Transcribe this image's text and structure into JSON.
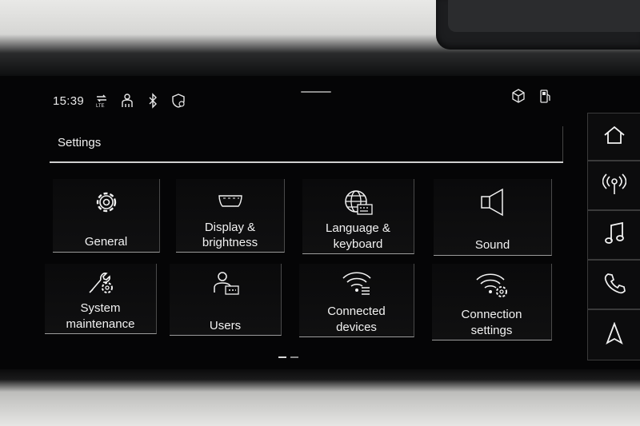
{
  "status_bar": {
    "time": "15:39",
    "icons": [
      "lte-data-icon",
      "person-icon",
      "bluetooth-icon",
      "location-shield-icon"
    ],
    "right_icons": [
      "package-icon",
      "fuel-icon"
    ]
  },
  "header": {
    "title": "Settings"
  },
  "tiles": [
    {
      "label": "General",
      "icon": "gear-icon"
    },
    {
      "label": "Display & brightness",
      "line1": "Display &",
      "line2": "brightness",
      "icon": "display-icon"
    },
    {
      "label": "Language & keyboard",
      "line1": "Language &",
      "line2": "keyboard",
      "icon": "globe-keyboard-icon"
    },
    {
      "label": "Sound",
      "icon": "speaker-icon"
    },
    {
      "label": "System maintenance",
      "line1": "System",
      "line2": "maintenance",
      "icon": "wrench-gear-icon"
    },
    {
      "label": "Users",
      "icon": "user-icon"
    },
    {
      "label": "Connected devices",
      "line1": "Connected",
      "line2": "devices",
      "icon": "wifi-devices-icon"
    },
    {
      "label": "Connection settings",
      "line1": "Connection",
      "line2": "settings",
      "icon": "wifi-gear-icon"
    }
  ],
  "rail": [
    "home-icon",
    "radio-icon",
    "music-icon",
    "phone-icon",
    "navigation-icon"
  ],
  "pagination": {
    "pages": 2,
    "current": 1
  },
  "colors": {
    "text": "#f2f2f2",
    "background": "#050506",
    "accent_line": "#cfcfcf"
  }
}
